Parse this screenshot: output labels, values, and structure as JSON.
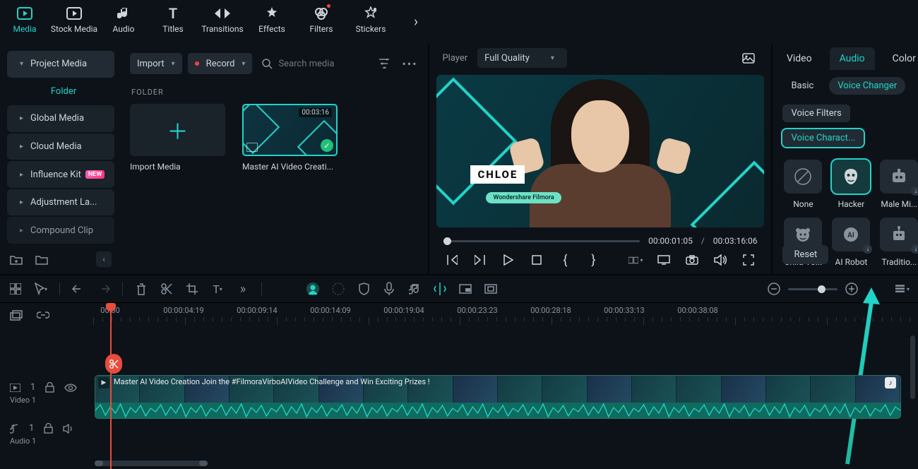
{
  "topnav": {
    "items": [
      {
        "id": "media",
        "label": "Media"
      },
      {
        "id": "stock",
        "label": "Stock Media"
      },
      {
        "id": "audio",
        "label": "Audio"
      },
      {
        "id": "titles",
        "label": "Titles"
      },
      {
        "id": "transitions",
        "label": "Transitions"
      },
      {
        "id": "effects",
        "label": "Effects"
      },
      {
        "id": "filters",
        "label": "Filters"
      },
      {
        "id": "stickers",
        "label": "Stickers"
      }
    ]
  },
  "sidebar": {
    "header": "Project Media",
    "folder_label": "Folder",
    "items": [
      {
        "label": "Global Media"
      },
      {
        "label": "Cloud Media"
      },
      {
        "label": "Influence Kit",
        "badge": "NEW"
      },
      {
        "label": "Adjustment La..."
      },
      {
        "label": "Compound Clip"
      }
    ]
  },
  "media_tools": {
    "import": "Import",
    "record": "Record",
    "search_placeholder": "Search media"
  },
  "media": {
    "folder_heading": "FOLDER",
    "import_card": "Import Media",
    "clip": {
      "caption": "Master AI Video Creati...",
      "duration": "00:03:16"
    }
  },
  "player": {
    "label": "Player",
    "quality": "Full Quality",
    "name_overlay": "CHLOE",
    "brand_overlay": "Wondershare Filmora",
    "current_time": "00:00:01:05",
    "total_time": "00:03:16:06"
  },
  "right_panel": {
    "tabs": {
      "video": "Video",
      "audio": "Audio",
      "color": "Color"
    },
    "subtabs": {
      "basic": "Basic",
      "voice_changer": "Voice Changer"
    },
    "voice_filters": "Voice Filters",
    "voice_characters": "Voice Charact...",
    "voices": [
      {
        "id": "none",
        "label": "None"
      },
      {
        "id": "hacker",
        "label": "Hacker"
      },
      {
        "id": "male",
        "label": "Male Mi..."
      },
      {
        "id": "child",
        "label": "Child Vo..."
      },
      {
        "id": "airobot",
        "label": "AI Robot"
      },
      {
        "id": "trad",
        "label": "Traditio..."
      }
    ],
    "reset": "Reset"
  },
  "timeline": {
    "timecodes": [
      "00:00",
      "00:00:04:19",
      "00:00:09:14",
      "00:00:14:09",
      "00:00:19:04",
      "00:00:23:23",
      "00:00:28:18",
      "00:00:33:13",
      "00:00:38:08"
    ],
    "clip_title": "Master AI Video Creation   Join the #FilmoraVirboAIVideo  Challenge and Win Exciting Prizes !",
    "tracks": {
      "video": "Video 1",
      "audio": "Audio 1",
      "video_count": "1",
      "audio_count": "1"
    }
  }
}
